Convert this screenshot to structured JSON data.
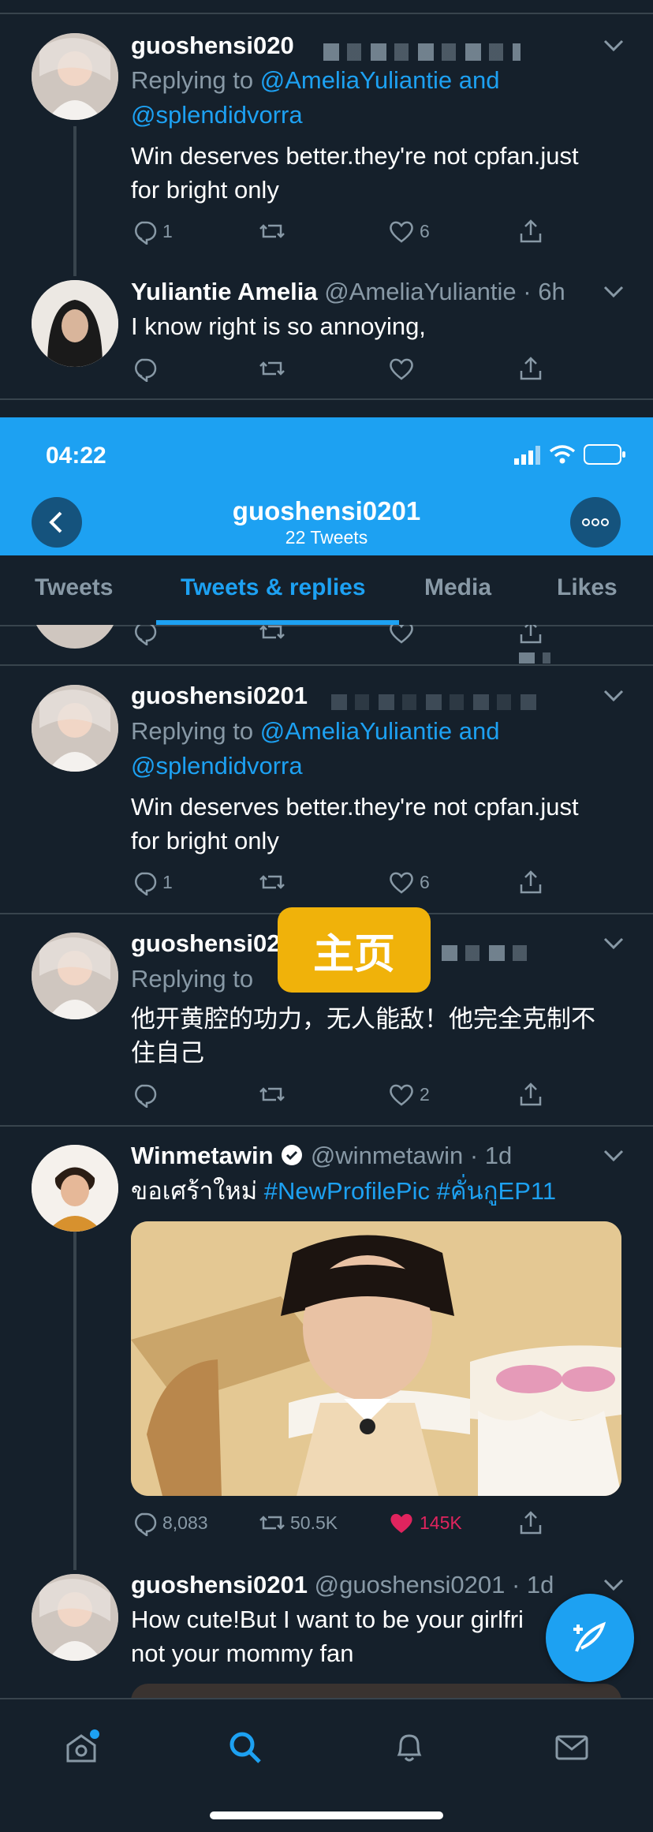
{
  "tweet1": {
    "name": "guoshensi020",
    "replying_prefix": "Replying to",
    "reply_to_1": "@AmeliaYuliantie and",
    "reply_to_2": "@splendidvorra",
    "text_line1": "Win deserves better.they're not cpfan.just",
    "text_line2": "for bright only",
    "reply_count": "1",
    "like_count": "6"
  },
  "tweet2": {
    "name": "Yuliantie Amelia",
    "handle": "@AmeliaYuliantie · 6h",
    "text": "I know right is so annoying,"
  },
  "statusbar": {
    "time": "04:22"
  },
  "profile_header": {
    "title": "guoshensi0201",
    "subtitle": "22 Tweets"
  },
  "tabs": [
    "Tweets",
    "Tweets & replies",
    "Media",
    "Likes"
  ],
  "tweet3": {
    "name": "guoshensi0201",
    "replying_prefix": "Replying to",
    "reply_to_1": "@AmeliaYuliantie and",
    "reply_to_2": "@splendidvorra",
    "text_line1": "Win deserves better.they're not cpfan.just",
    "text_line2": "for bright only",
    "reply_count": "1",
    "like_count": "6"
  },
  "tweet4": {
    "name": "guoshensi020",
    "replying_prefix": "Replying to",
    "text_line1": "他开黄腔的功力，无人能敌！他完全克制不",
    "text_line2": "住自己",
    "like_count": "2"
  },
  "overlay_badge": "主页",
  "tweet5": {
    "name": "Winmetawin",
    "handle": "@winmetawin · 1d",
    "text_thai": "ขอเศร้าใหม่ ",
    "hashtag1": "#NewProfilePic",
    "hashtag2": " #คั่นกูEP11",
    "reply_count": "8,083",
    "retweet_count": "50.5K",
    "like_count": "145K"
  },
  "tweet6": {
    "name": "guoshensi0201",
    "handle": "@guoshensi0201 · 1d",
    "text_line1": "How cute!But I want to be your girlfri",
    "text_line2": "not your mommy fan"
  },
  "colors": {
    "background": "#15202b",
    "accent": "#1da1f2",
    "muted": "#8899a6",
    "like_active": "#e0245e",
    "badge": "#f0b20a"
  },
  "icons": [
    "reply-icon",
    "retweet-icon",
    "like-icon",
    "share-icon",
    "chevron-down-icon",
    "back-icon",
    "more-icon",
    "compose-icon",
    "home-icon",
    "search-icon",
    "notifications-icon",
    "messages-icon",
    "verified-icon"
  ]
}
